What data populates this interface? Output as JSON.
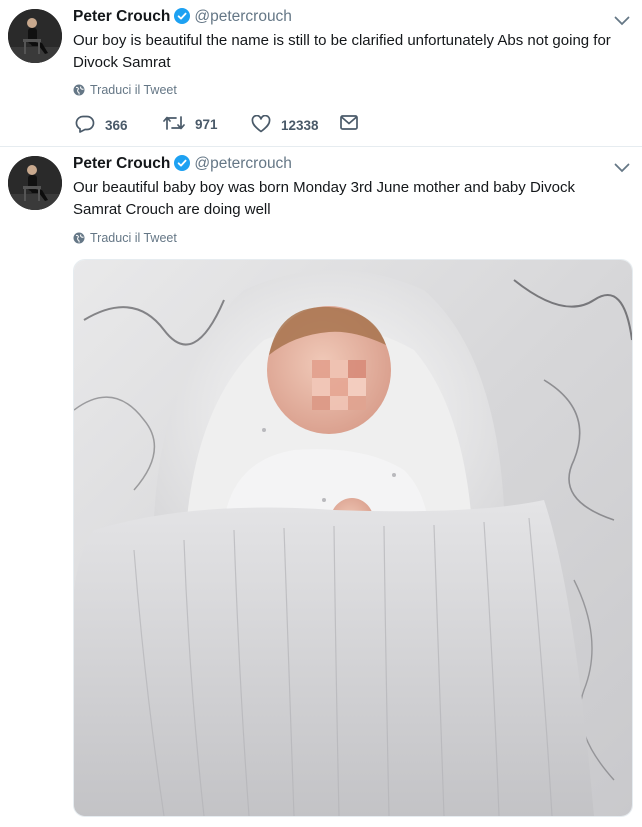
{
  "tweets": [
    {
      "author_name": "Peter Crouch",
      "handle": "@petercrouch",
      "text": "Our boy is beautiful the name is still to be clarified unfortunately Abs not going for Divock Samrat",
      "translate_label": "Traduci il Tweet",
      "replies": "366",
      "retweets": "971",
      "likes": "12338"
    },
    {
      "author_name": "Peter Crouch",
      "handle": "@petercrouch",
      "text": "Our beautiful baby boy was born Monday 3rd June mother and baby Divock Samrat Crouch are doing well",
      "translate_label": "Traduci il Tweet"
    }
  ],
  "colors": {
    "verified_blue": "#1da1f2",
    "secondary_text": "#657786",
    "action_icon": "#4a5a69"
  },
  "icons": [
    "verified-badge-icon",
    "chevron-down-icon",
    "globe-icon",
    "reply-icon",
    "retweet-icon",
    "like-icon",
    "message-icon"
  ]
}
